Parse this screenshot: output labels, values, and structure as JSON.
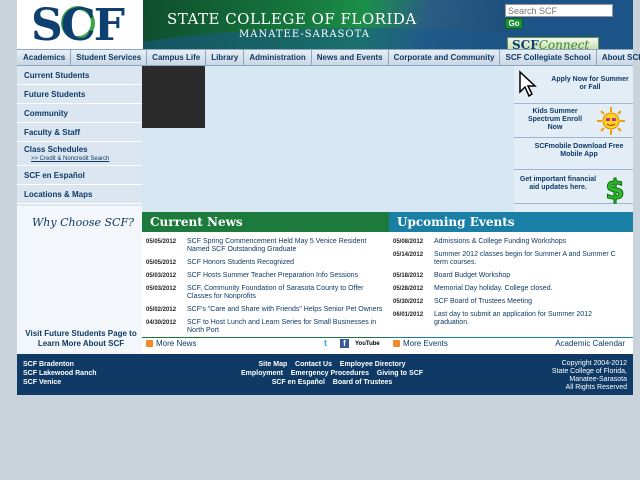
{
  "header": {
    "logo_text": "SCF",
    "banner_title": "STATE COLLEGE OF FLORIDA",
    "banner_subtitle": "MANATEE-SARASOTA",
    "search_placeholder": "Search SCF",
    "go_label": "Go",
    "connect_label_a": "SCF",
    "connect_label_b": "Connect"
  },
  "nav": {
    "items": [
      "Academics",
      "Student Services",
      "Campus Life",
      "Library",
      "Administration",
      "News and Events",
      "Corporate and Community",
      "SCF Collegiate School",
      "About SCF"
    ]
  },
  "sidebar": {
    "items": [
      {
        "label": "Current Students"
      },
      {
        "label": "Future Students"
      },
      {
        "label": "Community"
      },
      {
        "label": "Faculty & Staff"
      },
      {
        "label": "Class Schedules",
        "sub": ">> Credit & Noncredit Search"
      },
      {
        "label": "SCF en Español"
      },
      {
        "label": "Locations & Maps"
      }
    ]
  },
  "promos": [
    {
      "text": "Apply Now for Summer or Fall",
      "icon": "cursor-arrow-icon"
    },
    {
      "text": "Kids Summer Spectrum Enroll Now",
      "icon": "sun-icon"
    },
    {
      "text": "SCFmobile Download Free Mobile App",
      "icon": ""
    },
    {
      "text": "Get important financial aid updates here.",
      "icon": "dollar-sign-icon"
    }
  ],
  "why": {
    "title": "Why Choose SCF?",
    "link": "Visit Future Students Page to Learn More About SCF"
  },
  "news": {
    "heading": "Current News",
    "items": [
      {
        "date": "05/05/2012",
        "text": "SCF Spring Commencement Held May 5 Venice Resident Named SCF Outstanding Graduate"
      },
      {
        "date": "05/05/2012",
        "text": "SCF Honors Students Recognized"
      },
      {
        "date": "05/03/2012",
        "text": "SCF Hosts Summer Teacher Preparation Info Sessions"
      },
      {
        "date": "05/03/2012",
        "text": "SCF, Community Foundation of Sarasota County to Offer Classes for Nonprofits"
      },
      {
        "date": "05/02/2012",
        "text": "SCF's \"Care and Share with Friends\" Helps Senior Pet Owners"
      },
      {
        "date": "04/30/2012",
        "text": "SCF to Host Lunch and Learn Series for Small Businesses in North Port"
      }
    ],
    "more": "More News",
    "social": [
      "twitter-icon",
      "facebook-icon",
      "youtube-icon"
    ],
    "youtube_label": "YouTube"
  },
  "events": {
    "heading": "Upcoming Events",
    "items": [
      {
        "date": "05/08/2012",
        "text": "Admissions & College Funding Workshops"
      },
      {
        "date": "05/14/2012",
        "text": "Summer 2012 classes begin for Summer A and Summer C term courses."
      },
      {
        "date": "05/18/2012",
        "text": "Board Budget Workshop"
      },
      {
        "date": "05/28/2012",
        "text": "Memorial Day holiday. College closed."
      },
      {
        "date": "05/30/2012",
        "text": "SCF Board of Trustees Meeting"
      },
      {
        "date": "06/01/2012",
        "text": "Last day to submit an application for Summer 2012 graduation."
      }
    ],
    "more": "More Events",
    "calendar": "Academic Calendar"
  },
  "footer": {
    "campuses": [
      "SCF Bradenton",
      "SCF Lakewood Ranch",
      "SCF Venice"
    ],
    "links_row1": [
      "Site Map",
      "Contact Us",
      "Employee Directory"
    ],
    "links_row2": [
      "Employment",
      "Emergency Procedures",
      "Giving to SCF"
    ],
    "links_row3": [
      "SCF en Español",
      "Board of Trustees"
    ],
    "copyright": [
      "Copyright 2004-2012",
      "State College of Florida,",
      "Manatee-Sarasota",
      "All Rights Reserved"
    ]
  }
}
